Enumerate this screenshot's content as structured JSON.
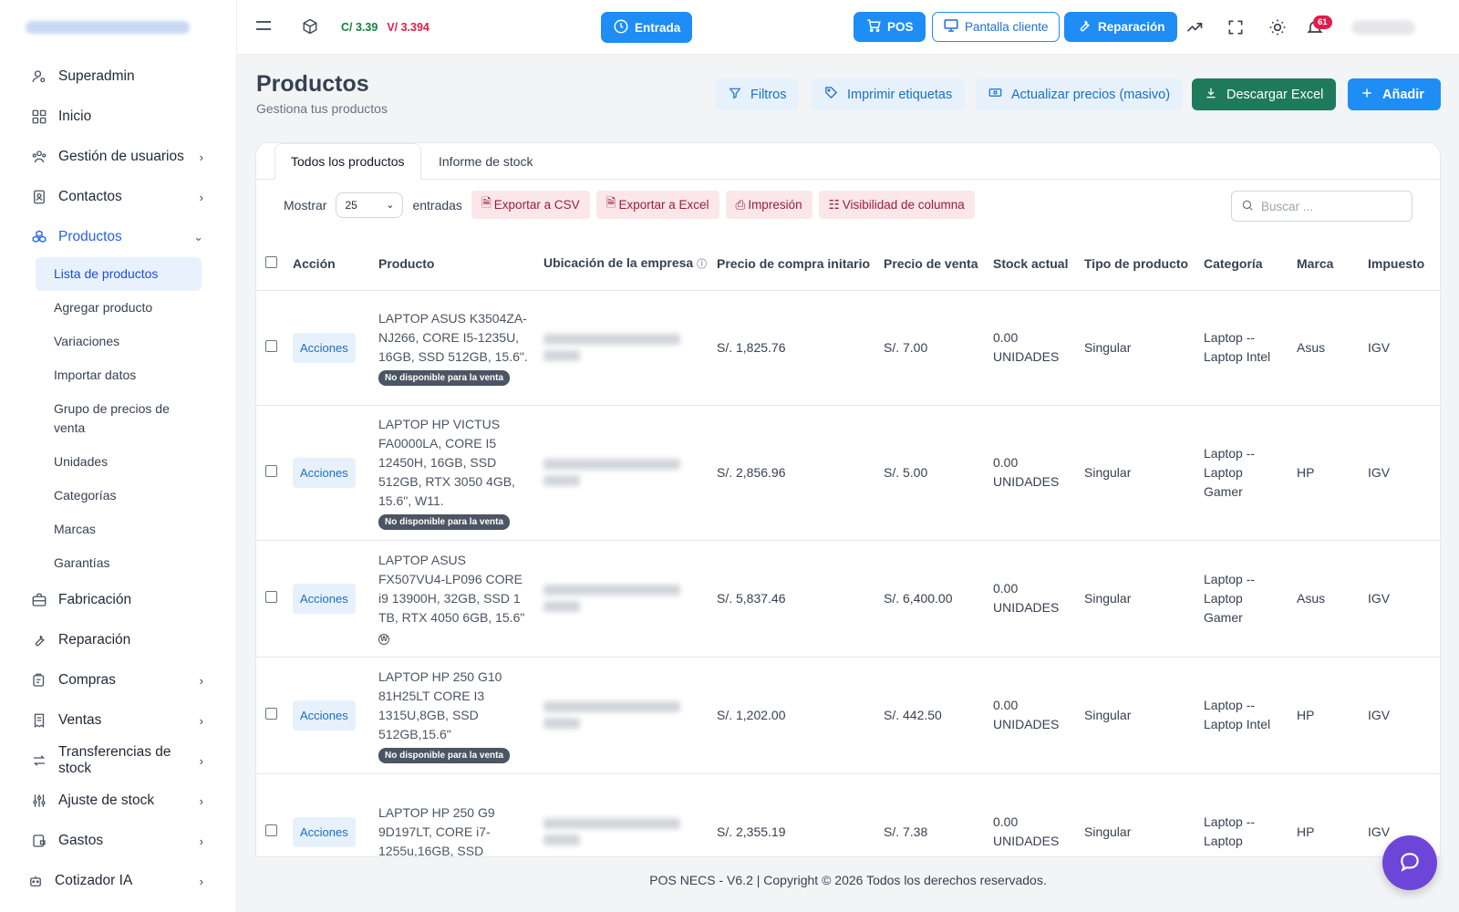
{
  "sidebar": {
    "items": [
      {
        "label": "Superadmin",
        "icon": "user-gear-icon",
        "chev": false
      },
      {
        "label": "Inicio",
        "icon": "dashboard-icon",
        "chev": false
      },
      {
        "label": "Gestión de usuarios",
        "icon": "users-icon",
        "chev": true
      },
      {
        "label": "Contactos",
        "icon": "contacts-icon",
        "chev": true
      },
      {
        "label": "Productos",
        "icon": "cubes-icon",
        "chev": true,
        "active": true
      }
    ],
    "sub_items": [
      {
        "label": "Lista de productos",
        "active": true
      },
      {
        "label": "Agregar producto"
      },
      {
        "label": "Variaciones"
      },
      {
        "label": "Importar datos"
      },
      {
        "label": "Grupo de precios de venta"
      },
      {
        "label": "Unidades"
      },
      {
        "label": "Categorías"
      },
      {
        "label": "Marcas"
      },
      {
        "label": "Garantías"
      }
    ],
    "items_after": [
      {
        "label": "Fabricación",
        "icon": "factory-icon",
        "chev": false
      },
      {
        "label": "Reparación",
        "icon": "wrench-icon",
        "chev": false
      },
      {
        "label": "Compras",
        "icon": "cart-icon",
        "chev": true
      },
      {
        "label": "Ventas",
        "icon": "receipt-icon",
        "chev": true
      },
      {
        "label": "Transferencias de stock",
        "icon": "transfer-icon",
        "chev": true
      },
      {
        "label": "Ajuste de stock",
        "icon": "sliders-icon",
        "chev": true
      },
      {
        "label": "Gastos",
        "icon": "wallet-icon",
        "chev": true
      },
      {
        "label": "Cotizador IA",
        "icon": "robot-icon",
        "chev": true
      }
    ]
  },
  "topbar": {
    "price_c": "C/ 3.39",
    "price_v": "V/ 3.394",
    "entrada": "Entrada",
    "pos": "POS",
    "pantalla": "Pantalla cliente",
    "reparacion": "Reparación",
    "notif_count": "61"
  },
  "page": {
    "title": "Productos",
    "subtitle": "Gestiona tus productos",
    "btn_filtros": "Filtros",
    "btn_imprimir": "Imprimir etiquetas",
    "btn_actualizar": "Actualizar precios (masivo)",
    "btn_descargar": "Descargar Excel",
    "btn_anadir": "Añadir"
  },
  "tabs": {
    "all": "Todos los productos",
    "stock": "Informe de stock"
  },
  "toolbar": {
    "mostrar": "Mostrar",
    "entries_value": "25",
    "entradas": "entradas",
    "csv": "Exportar a CSV",
    "excel": "Exportar a Excel",
    "print": "Impresión",
    "visibility": "Visibilidad de columna",
    "search_placeholder": "Buscar ..."
  },
  "table": {
    "headers": [
      "Acción",
      "Producto",
      "Ubicación de la empresa",
      "Precio de compra initario",
      "Precio de venta",
      "Stock actual",
      "Tipo de producto",
      "Categoría",
      "Marca",
      "Impuesto"
    ],
    "action_label": "Acciones",
    "badge_label": "No disponible para la venta",
    "rows": [
      {
        "product": "LAPTOP ASUS K3504ZA-NJ266, CORE I5-1235U, 16GB, SSD 512GB, 15.6\".",
        "buy": "S/. 1,825.76",
        "sell": "S/. 7.00",
        "stock": "0.00 UNIDADES",
        "type": "Singular",
        "category": "Laptop -- Laptop Intel",
        "brand": "Asus",
        "tax": "IGV"
      },
      {
        "product": "LAPTOP HP VICTUS FA0000LA, CORE I5 12450H, 16GB, SSD 512GB, RTX 3050 4GB, 15.6\", W11.",
        "buy": "S/. 2,856.96",
        "sell": "S/. 5.00",
        "stock": "0.00 UNIDADES",
        "type": "Singular",
        "category": "Laptop -- Laptop Gamer",
        "brand": "HP",
        "tax": "IGV"
      },
      {
        "product": "LAPTOP ASUS FX507VU4-LP096 CORE i9 13900H, 32GB, SSD 1 TB, RTX 4050 6GB, 15.6\"",
        "buy": "S/. 5,837.46",
        "sell": "S/. 6,400.00",
        "stock": "0.00 UNIDADES",
        "type": "Singular",
        "category": "Laptop -- Laptop Gamer",
        "brand": "Asus",
        "tax": "IGV"
      },
      {
        "product": "LAPTOP HP 250 G10 81H25LT CORE I3 1315U,8GB, SSD 512GB,15.6\"",
        "buy": "S/. 1,202.00",
        "sell": "S/. 442.50",
        "stock": "0.00 UNIDADES",
        "type": "Singular",
        "category": "Laptop -- Laptop Intel",
        "brand": "HP",
        "tax": "IGV"
      },
      {
        "product": "LAPTOP HP 250 G9 9D197LT, CORE i7-1255u,16GB, SSD",
        "buy": "S/. 2,355.19",
        "sell": "S/. 7.38",
        "stock": "0.00 UNIDADES",
        "type": "Singular",
        "category": "Laptop -- Laptop",
        "brand": "HP",
        "tax": "IGV"
      }
    ]
  },
  "footer": {
    "text": "POS NECS - V6.2 | Copyright © 2026 Todos los derechos reservados."
  }
}
